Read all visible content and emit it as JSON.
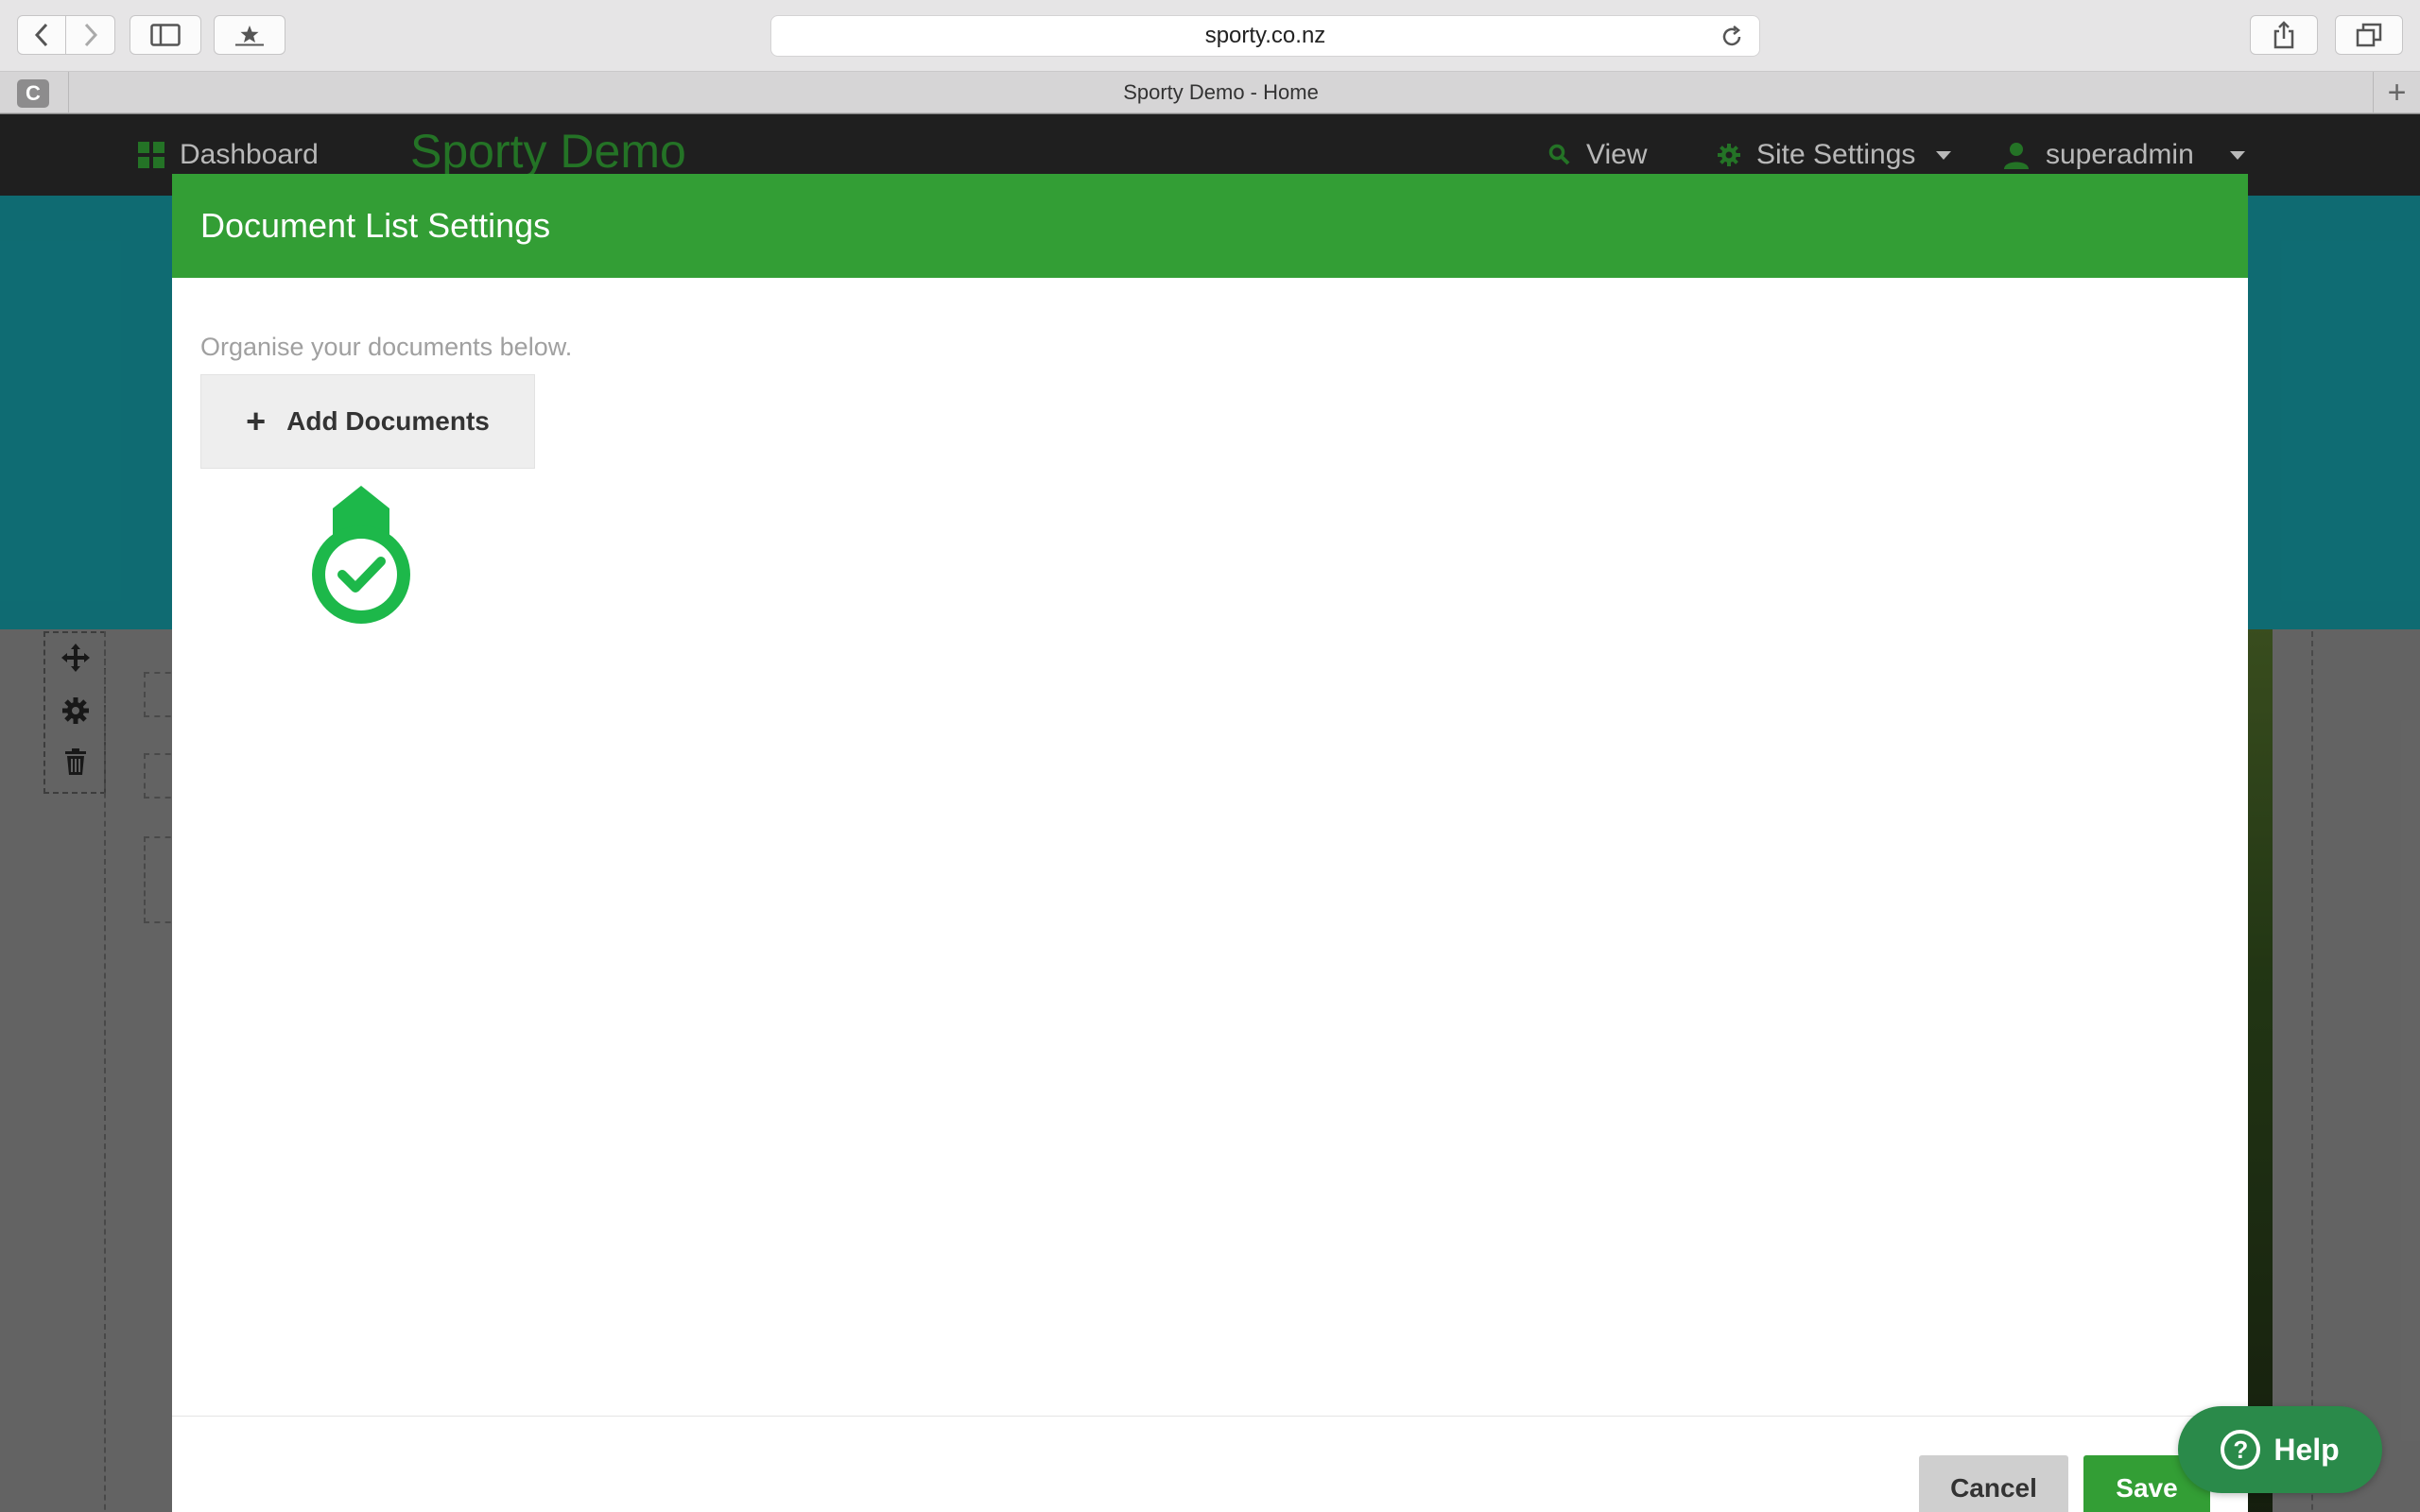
{
  "browser": {
    "url": "sporty.co.nz",
    "tab_title": "Sporty Demo - Home",
    "tab_favicon_letter": "C",
    "new_tab_symbol": "+"
  },
  "admin_bar": {
    "dashboard_label": "Dashboard",
    "brand": "Sporty Demo",
    "view_label": "View",
    "site_settings_label": "Site Settings",
    "user_label": "superadmin"
  },
  "modal": {
    "title": "Document List Settings",
    "instruction": "Organise your documents below.",
    "add_button_label": "Add Documents",
    "cancel_label": "Cancel",
    "save_label": "Save"
  },
  "help": {
    "label": "Help",
    "symbol": "?"
  },
  "colors": {
    "brand_green": "#339e35",
    "hero_teal": "#15959f",
    "admin_bar": "#2b2b2b",
    "marker_green": "#1db84a"
  }
}
